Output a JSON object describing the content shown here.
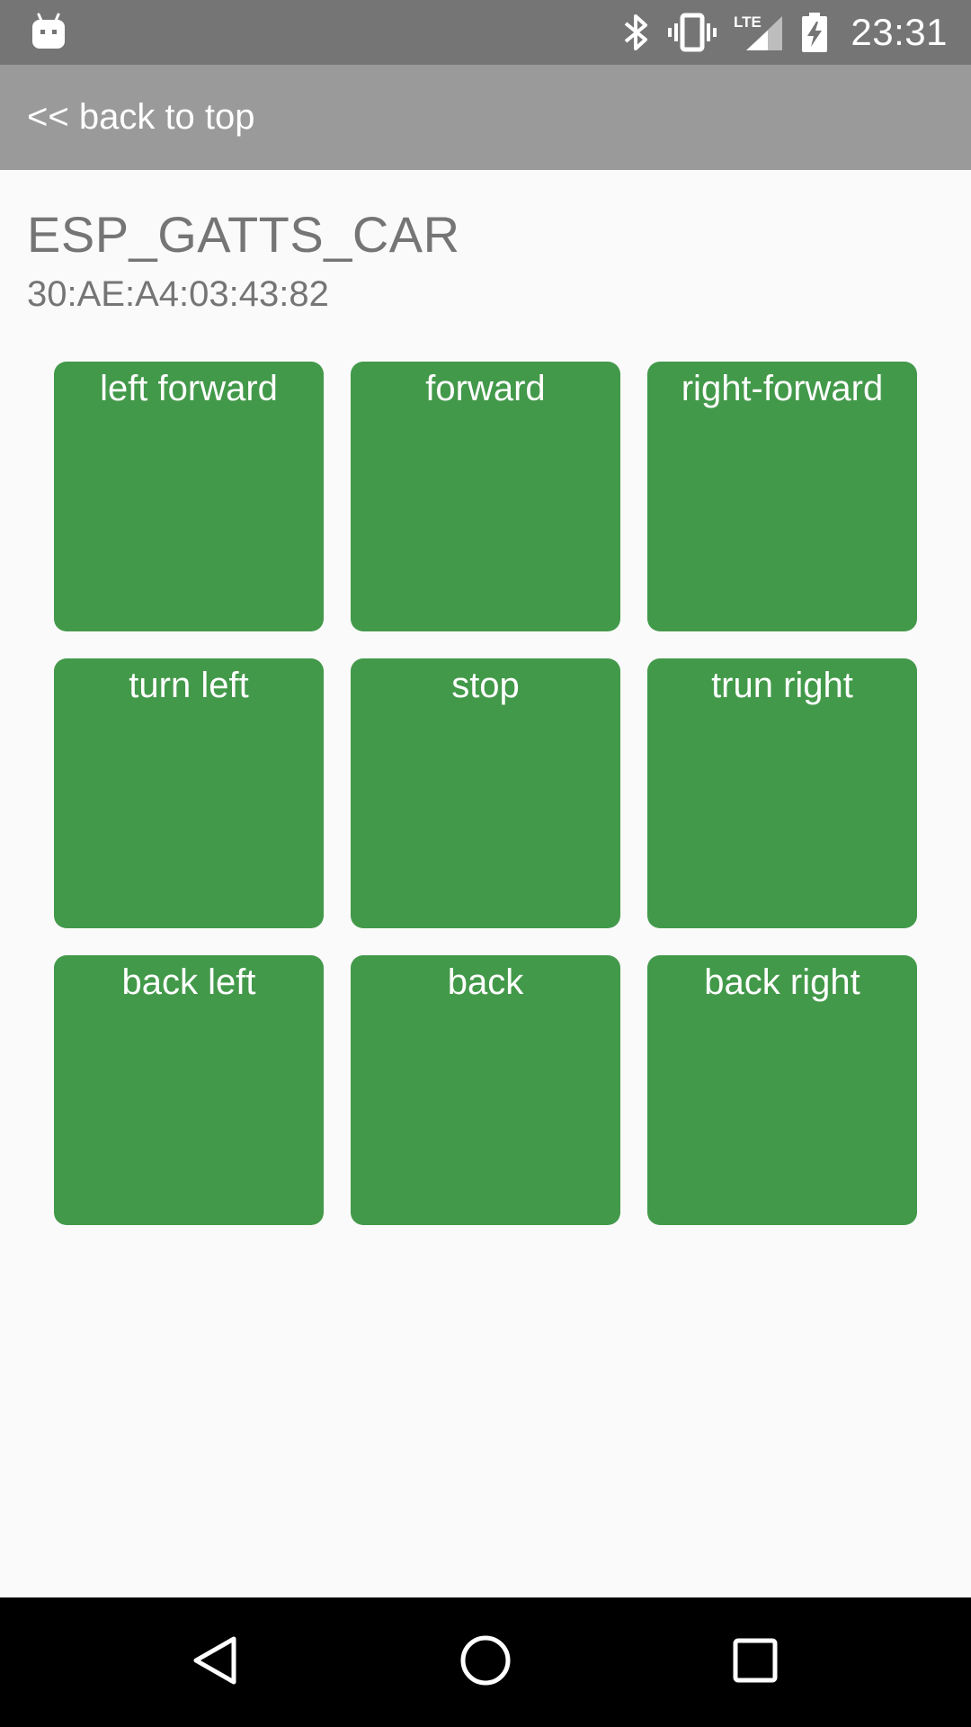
{
  "status_bar": {
    "time": "23:31",
    "icons": [
      "android-debug-icon",
      "bluetooth-icon",
      "vibrate-icon",
      "lte-signal-icon",
      "battery-charging-icon"
    ],
    "lte_label": "LTE"
  },
  "action_bar": {
    "back_label": "<< back to top"
  },
  "device": {
    "name": "ESP_GATTS_CAR",
    "address": "30:AE:A4:03:43:82"
  },
  "controls": [
    {
      "label": "left forward"
    },
    {
      "label": "forward"
    },
    {
      "label": "right-forward"
    },
    {
      "label": "turn left"
    },
    {
      "label": "stop"
    },
    {
      "label": "trun right"
    },
    {
      "label": "back left"
    },
    {
      "label": "back"
    },
    {
      "label": "back right"
    }
  ],
  "colors": {
    "status_bar": "#757575",
    "action_bar": "#9a9a9a",
    "button": "#43994a",
    "text_muted": "#757575",
    "nav_bar": "#000000"
  },
  "nav_bar": {
    "icons": [
      "back-triangle-icon",
      "home-circle-icon",
      "recents-square-icon"
    ]
  }
}
